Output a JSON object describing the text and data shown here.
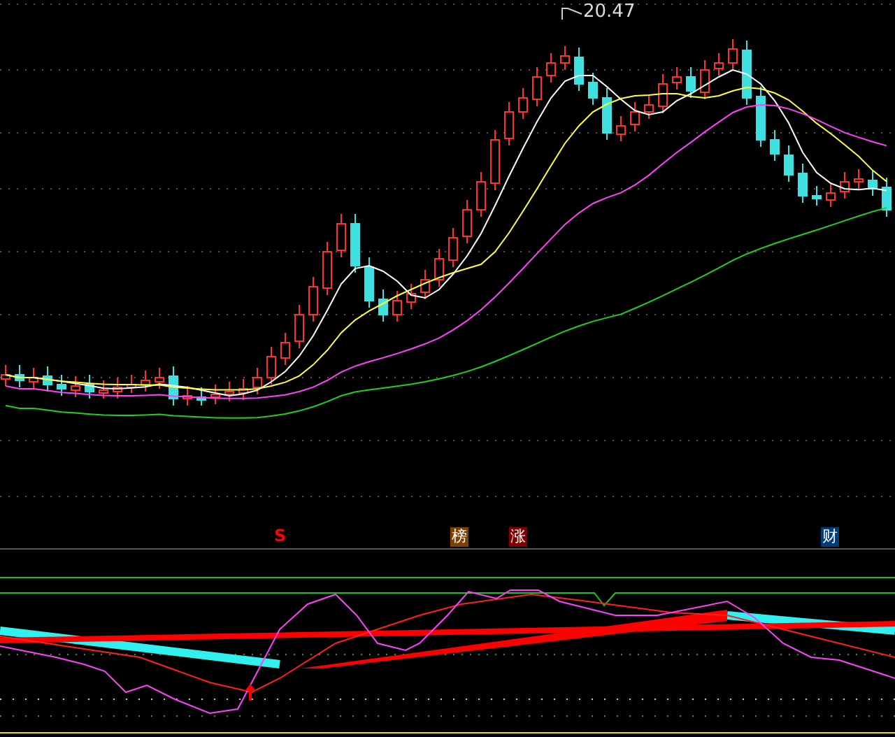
{
  "price_label": {
    "text": "20.47"
  },
  "markers": [
    {
      "kind": "signal",
      "text": "S",
      "color": "#ff0000"
    },
    {
      "kind": "tag",
      "text": "榜",
      "color": "#804000"
    },
    {
      "kind": "tag",
      "text": "涨",
      "color": "#800000"
    },
    {
      "kind": "tag",
      "text": "财",
      "color": "#003c78"
    }
  ]
}
